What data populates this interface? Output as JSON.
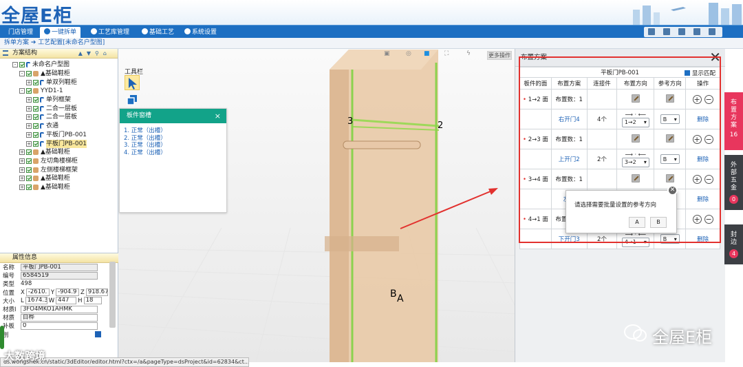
{
  "app": {
    "logo": "全屋E柜"
  },
  "nav": {
    "tabs": [
      {
        "label": "门店管理",
        "active": false
      },
      {
        "label": "一键拆单",
        "active": true
      },
      {
        "label": "工艺库管理",
        "active": false
      },
      {
        "label": "基础工艺",
        "active": false
      },
      {
        "label": "系统设置",
        "active": false
      }
    ]
  },
  "breadcrumb": "拆单方案 ➔ 工艺配置[未命名户型图]",
  "tree": {
    "title": "方案结构",
    "nodes": [
      {
        "label": "未命名户型图",
        "depth": 0,
        "expander": "-",
        "icon": "flag"
      },
      {
        "label": "▲基础鞋柜",
        "depth": 1,
        "expander": "-",
        "icon": "cab"
      },
      {
        "label": "单双列鞋柜",
        "depth": 2,
        "expander": "+",
        "icon": "flag"
      },
      {
        "label": "YYD1-1",
        "depth": 1,
        "expander": "-",
        "icon": "cab"
      },
      {
        "label": "单列框架",
        "depth": 2,
        "expander": "+",
        "icon": "flag"
      },
      {
        "label": "二合一层板",
        "depth": 2,
        "expander": "+",
        "icon": "flag"
      },
      {
        "label": "二合一层板",
        "depth": 2,
        "expander": "+",
        "icon": "flag"
      },
      {
        "label": "衣通",
        "depth": 2,
        "expander": "+",
        "icon": "flag"
      },
      {
        "label": "平板门PB-001",
        "depth": 2,
        "expander": "+",
        "icon": "flag"
      },
      {
        "label": "平板门PB-001",
        "depth": 2,
        "expander": "+",
        "icon": "flag",
        "selected": true
      },
      {
        "label": "▲基础鞋柜",
        "depth": 1,
        "expander": "+",
        "icon": "cab"
      },
      {
        "label": "左切角楼梯柜",
        "depth": 1,
        "expander": "+",
        "icon": "cab"
      },
      {
        "label": "左侧楼梯框架",
        "depth": 1,
        "expander": "+",
        "icon": "cab"
      },
      {
        "label": "▲基础鞋柜",
        "depth": 1,
        "expander": "+",
        "icon": "cab"
      },
      {
        "label": "▲基础鞋柜",
        "depth": 1,
        "expander": "+",
        "icon": "cab"
      }
    ]
  },
  "props": {
    "title": "属性信息",
    "name_label": "名称",
    "name": "平板门PB-001",
    "code_label": "编号",
    "code": "6584519",
    "type_label": "类型",
    "type": "498",
    "pos_label": "位置",
    "x_label": "X",
    "x": "-2610.",
    "y_label": "Y",
    "y": "-904.9",
    "z_label": "Z",
    "z": "918.67",
    "size_label": "大小",
    "l_label": "L",
    "l": "1674.3",
    "w_label": "W",
    "w": "447",
    "h_label": "H",
    "h": "18",
    "material_id_label": "材质I",
    "material_id": "3FO4MKO1AHMK",
    "material_label": "材质",
    "material": "白桦",
    "backboard_label": "补板",
    "backboard": "0",
    "last_label": "刨"
  },
  "toolbar": {
    "label": "工具栏",
    "more_ops": "更多操作"
  },
  "board_popup": {
    "title": "板件窗槽",
    "close": "×",
    "items": [
      "1. 正常（出槽）",
      "2. 正常（出槽）",
      "3. 正常（出槽）",
      "4. 正常（出槽）"
    ]
  },
  "scene_labels": {
    "p3": "3",
    "p2": "2",
    "pB": "B",
    "pA": "A"
  },
  "panel": {
    "title": "布置方案",
    "close": "✕",
    "table_title": "平板门PB-001",
    "show_match_label": "显示匹配",
    "show_match_checked": true,
    "headers": [
      "板件的面",
      "布置方案",
      "连接件",
      "布置方向",
      "参考方向",
      "操作"
    ],
    "groups": [
      {
        "face": "1→2 面",
        "count_text": "布置数：1",
        "plan": "右开门4",
        "connectors": "4个",
        "direction": "1→2",
        "ref": "B",
        "delete": "删除"
      },
      {
        "face": "2→3 面",
        "count_text": "布置数：1",
        "plan": "上开门2",
        "connectors": "2个",
        "direction": "3→2",
        "ref": "B",
        "delete": "删除"
      },
      {
        "face": "3→4 面",
        "count_text": "布置数：1",
        "plan": "左开",
        "connectors": "",
        "direction": "",
        "ref": "",
        "delete": "删除"
      },
      {
        "face": "4→1 面",
        "count_text": "布置数：1",
        "plan": "下开门3",
        "connectors": "2个",
        "direction": "4→1",
        "ref": "B",
        "delete": "删除"
      }
    ]
  },
  "side_tabs": [
    {
      "label": "布置方案",
      "count": "16",
      "color": "#e8365d"
    },
    {
      "label": "外部五金",
      "count": "0",
      "color": "#3c3f44"
    },
    {
      "label": "封边",
      "count": "4",
      "color": "#3c3f44"
    }
  ],
  "dialog": {
    "message": "请选择需要批量设置的参考方向",
    "btn_a": "A",
    "btn_b": "B",
    "close": "✕"
  },
  "status_url": "ds.wongshek.cn/static/3dEditor/editor.html?ctx=/a&pageType=dsProject&id=62834&ct...",
  "watermark": {
    "left": "大数跨境",
    "right": "全屋E柜"
  },
  "colors": {
    "nav": "#1d6fc2",
    "accent": "#e2312e",
    "popup_header": "#12a389"
  }
}
